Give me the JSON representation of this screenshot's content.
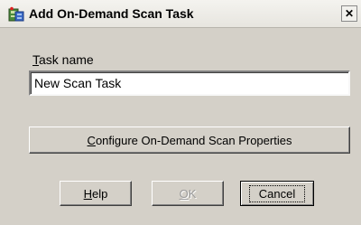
{
  "window": {
    "title": "Add On-Demand Scan Task",
    "icon": "scan-task-app-icon",
    "close_glyph": "✕"
  },
  "form": {
    "task_name_label_accel": "T",
    "task_name_label_rest": "ask name",
    "task_name_value": "New Scan Task"
  },
  "buttons": {
    "configure_accel": "C",
    "configure_rest": "onfigure On-Demand Scan Properties",
    "help_accel": "H",
    "help_rest": "elp",
    "ok_accel": "O",
    "ok_rest": "K",
    "cancel_label": "Cancel",
    "ok_enabled": false
  }
}
